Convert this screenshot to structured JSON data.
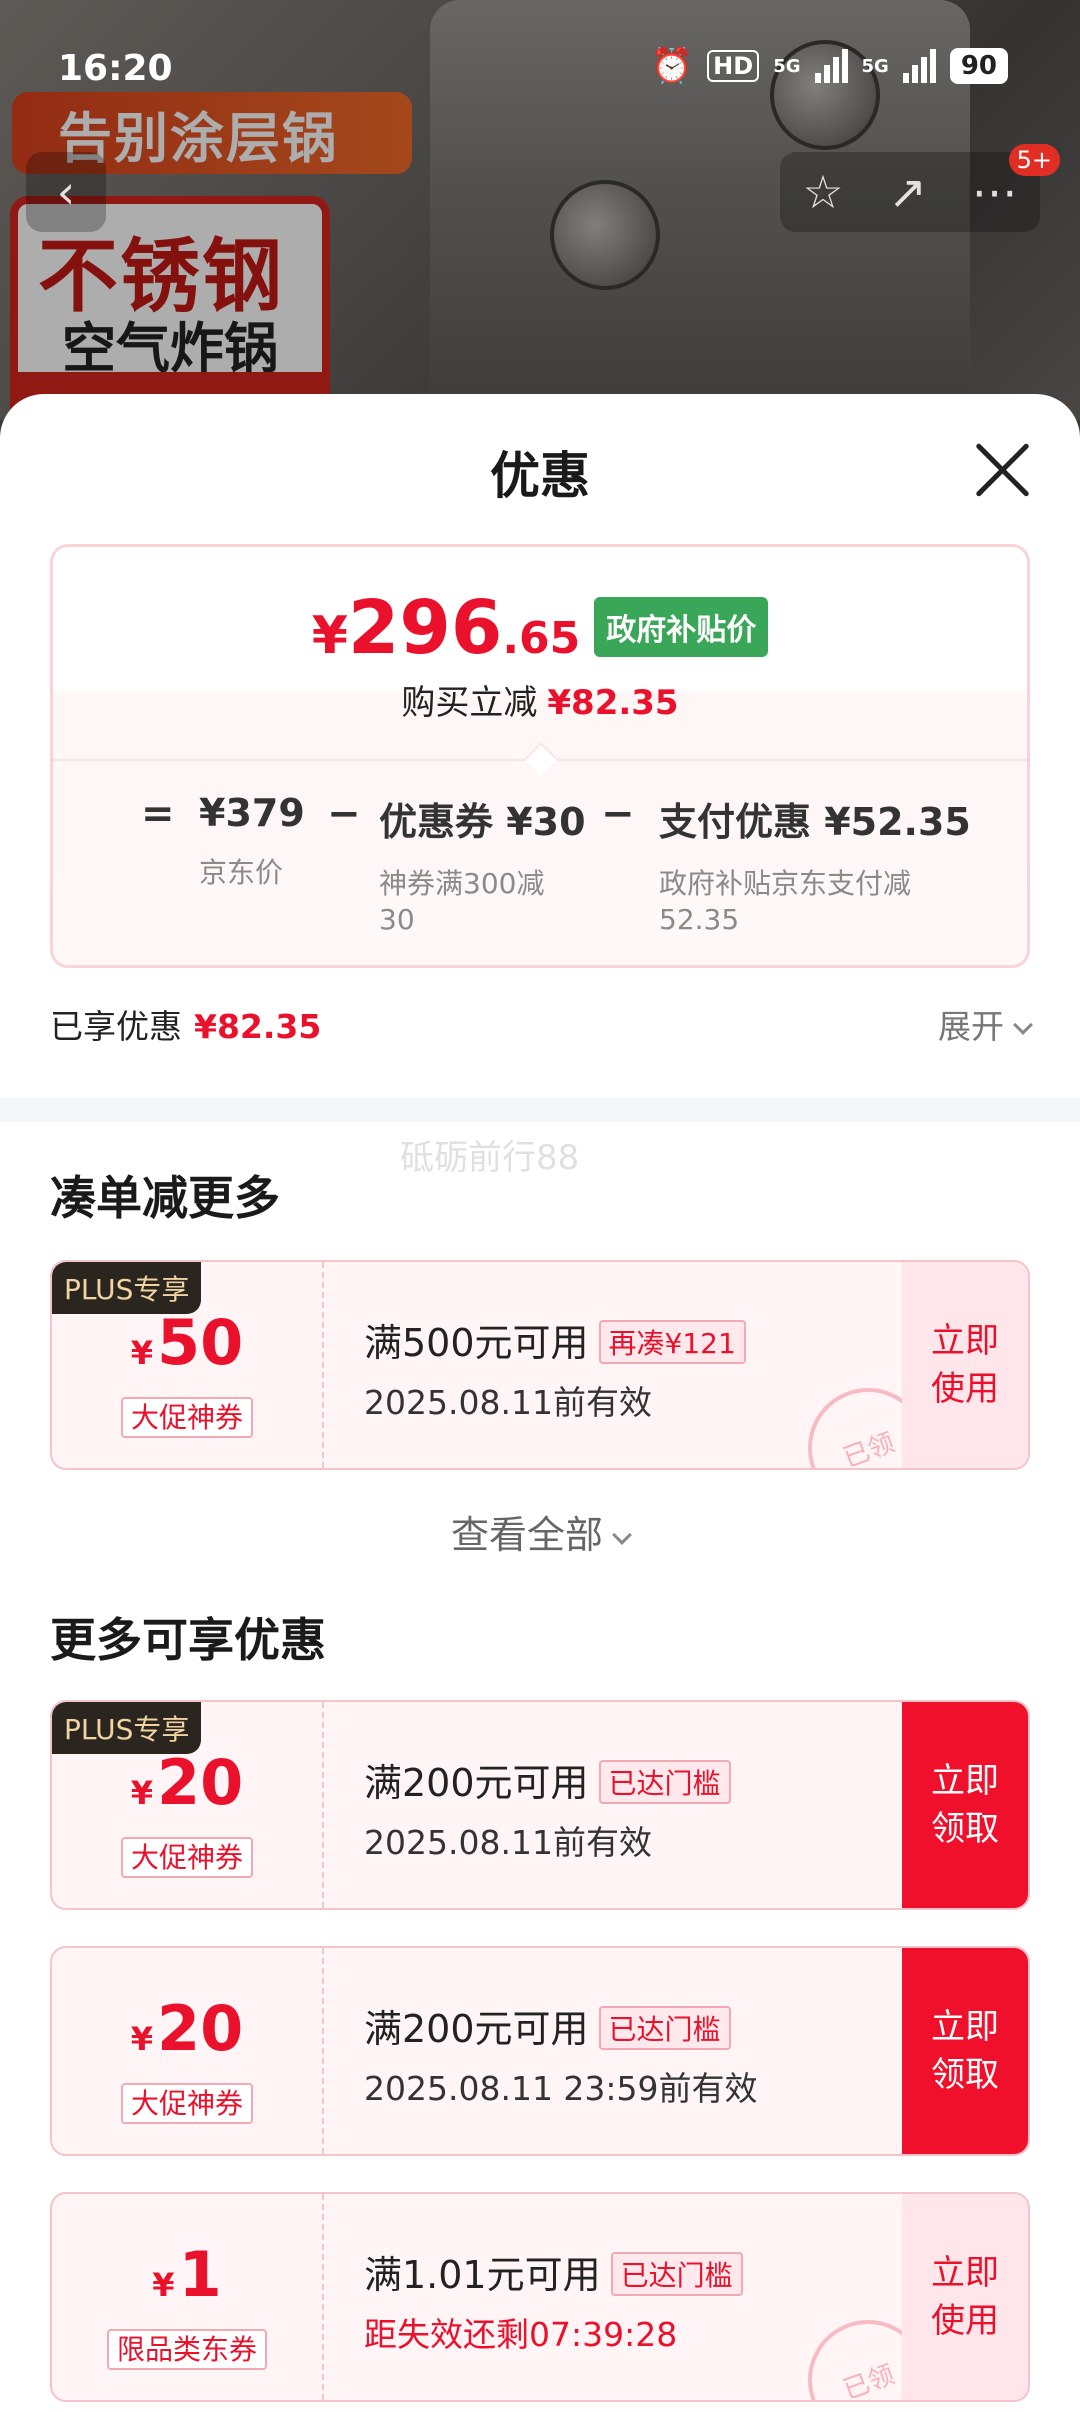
{
  "status_bar": {
    "time": "16:20",
    "hd": "HD",
    "net1": "5G",
    "net2": "5G",
    "battery": "90"
  },
  "background": {
    "tagline": "告别涂层锅",
    "badge_line1": "不锈钢",
    "badge_line2": "空气炸锅"
  },
  "nav": {
    "back_icon": "chevron-left-icon",
    "message_count": "5+"
  },
  "sheet": {
    "title": "优惠",
    "price": {
      "currency": "¥",
      "integer": "296",
      "decimal": ".65",
      "tag": "政府补贴价",
      "reduce_label": "购买立减",
      "reduce_value": "¥82.35"
    },
    "formula": {
      "eq": "=",
      "minus": "−",
      "items": [
        {
          "value": "¥379",
          "desc": "京东价"
        },
        {
          "value": "优惠券 ¥30",
          "desc": "神券满300减30"
        },
        {
          "value": "支付优惠 ¥52.35",
          "desc": "政府补贴京东支付减52.35"
        }
      ]
    },
    "enjoyed_label": "已享优惠",
    "enjoyed_value": "¥82.35",
    "expand_label": "展开",
    "watermark": "砥砺前行88",
    "section1_title": "凑单减更多",
    "coupon1": {
      "tag": "PLUS专享",
      "currency": "¥",
      "amount": "50",
      "type": "大促神券",
      "condition": "满500元可用",
      "pill": "再凑¥121",
      "expiry": "2025.08.11前有效",
      "action_line1": "立即",
      "action_line2": "使用",
      "stamp": "已领"
    },
    "view_all": "查看全部",
    "section2_title": "更多可享优惠",
    "coupon2": {
      "tag": "PLUS专享",
      "currency": "¥",
      "amount": "20",
      "type": "大促神券",
      "condition": "满200元可用",
      "pill": "已达门槛",
      "expiry": "2025.08.11前有效",
      "action_line1": "立即",
      "action_line2": "领取"
    },
    "coupon3": {
      "currency": "¥",
      "amount": "20",
      "type": "大促神券",
      "condition": "满200元可用",
      "pill": "已达门槛",
      "expiry": "2025.08.11 23:59前有效",
      "action_line1": "立即",
      "action_line2": "领取"
    },
    "coupon4": {
      "currency": "¥",
      "amount": "1",
      "type": "限品类东券",
      "condition": "满1.01元可用",
      "pill": "已达门槛",
      "expiry": "距失效还剩07:39:28",
      "action_line1": "立即",
      "action_line2": "使用",
      "stamp": "已领"
    }
  },
  "colors": {
    "accent_red": "#e9112b",
    "gov_green": "#3aa658",
    "plus_dark": "#2b2520"
  }
}
